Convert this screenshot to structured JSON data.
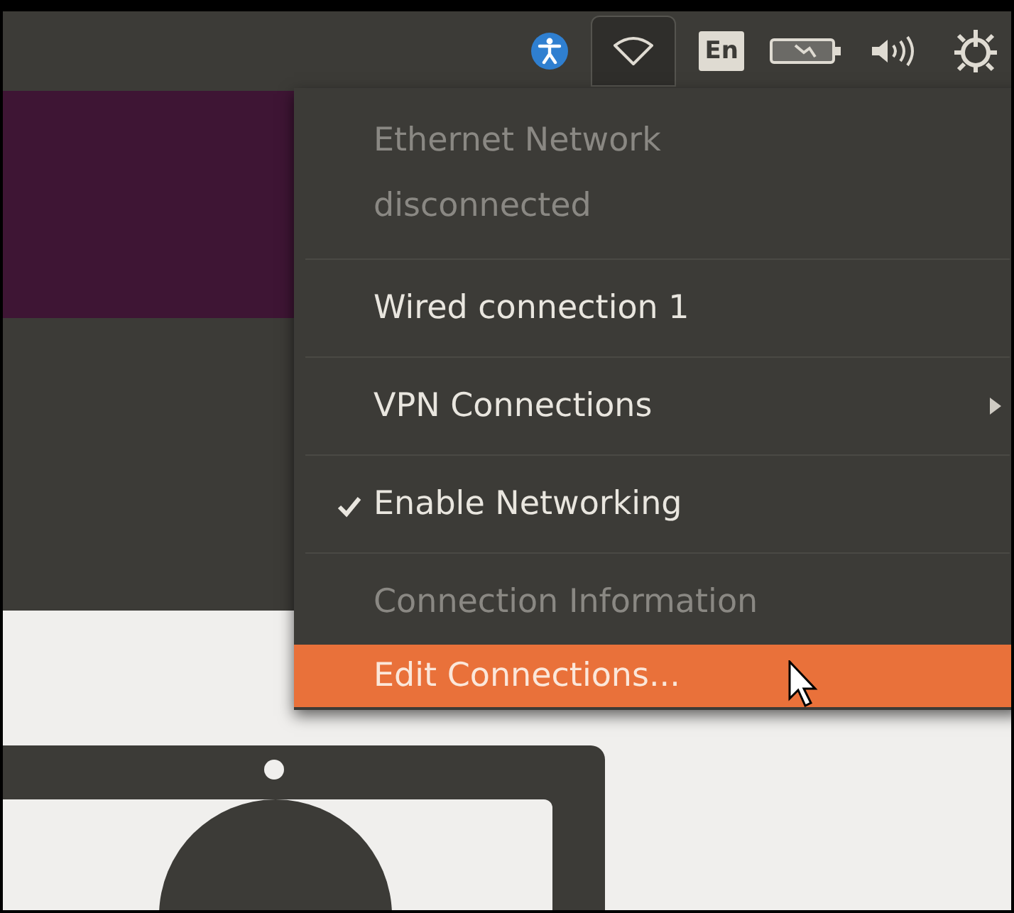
{
  "panel": {
    "indicators": [
      {
        "kind": "accessibility",
        "selected": false
      },
      {
        "kind": "network",
        "selected": true
      },
      {
        "kind": "keyboard",
        "label": "En",
        "selected": false
      },
      {
        "kind": "battery",
        "selected": false
      },
      {
        "kind": "volume",
        "selected": false
      },
      {
        "kind": "power",
        "selected": false
      }
    ]
  },
  "network_menu": {
    "items": [
      {
        "kind": "info",
        "label": "Ethernet Network\ndisconnected",
        "disabled": true,
        "checked": false,
        "submenu": false,
        "selected": false
      },
      {
        "kind": "separator"
      },
      {
        "kind": "item",
        "label": "Wired connection 1",
        "disabled": false,
        "checked": false,
        "submenu": false,
        "selected": false
      },
      {
        "kind": "separator"
      },
      {
        "kind": "item",
        "label": "VPN Connections",
        "disabled": false,
        "checked": false,
        "submenu": true,
        "selected": false
      },
      {
        "kind": "separator"
      },
      {
        "kind": "item",
        "label": "Enable Networking",
        "disabled": false,
        "checked": true,
        "submenu": false,
        "selected": false
      },
      {
        "kind": "separator"
      },
      {
        "kind": "item",
        "label": "Connection Information",
        "disabled": true,
        "checked": false,
        "submenu": false,
        "selected": false
      },
      {
        "kind": "item",
        "label": "Edit Connections...",
        "disabled": false,
        "checked": false,
        "submenu": false,
        "selected": true
      }
    ]
  }
}
